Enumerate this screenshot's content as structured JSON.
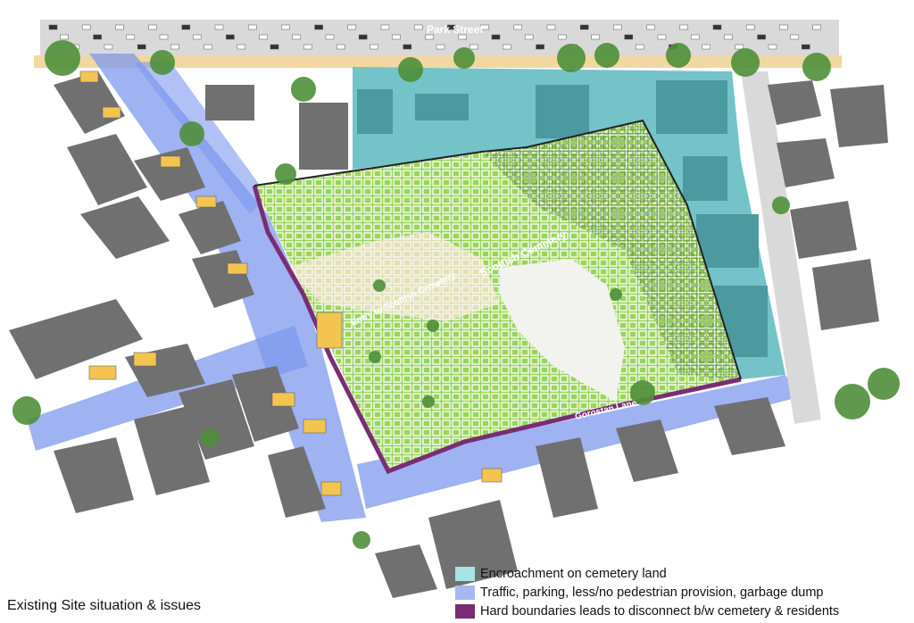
{
  "title": "Existing Site situation & issues",
  "labels": {
    "park_street": "Park Street",
    "cemetery": "Scottish Cemetery",
    "entry": "Entry to Scottish Cemetery",
    "gorostan_lane": "Gorostan Lane"
  },
  "legend": [
    {
      "label": "Encroachment on cemetery land",
      "color": "#a8e3e6"
    },
    {
      "label": "Traffic, parking, less/no pedestrian provision, garbage dump",
      "color": "#a7b8f0"
    },
    {
      "label": "Hard boundaries leads to disconnect b/w cemetery & residents",
      "color": "#7a2c74"
    }
  ],
  "colors": {
    "building": "#707070",
    "road": "#d9d9d9",
    "traffic_zone": "#7f98ee",
    "encroachment": "#5ab9bf",
    "cemetery_grass": "#9ad45c",
    "cemetery_open": "#f2f2ee",
    "boundary": "#7a2c74",
    "footpath": "#f0d9a0",
    "tree": "#4f8f3a",
    "shop": "#f3c550"
  }
}
